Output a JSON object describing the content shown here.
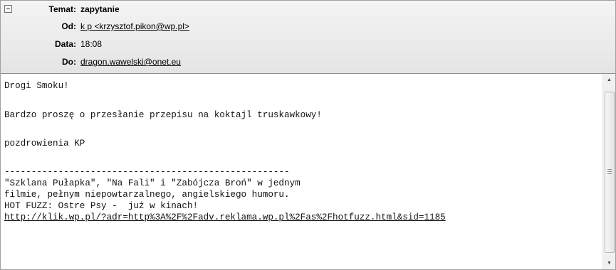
{
  "header": {
    "collapse_icon": "minus-box-icon",
    "subject": {
      "label": "Temat:",
      "value": "zapytanie"
    },
    "from": {
      "label": "Od:",
      "value": "k p <krzysztof.pikon@wp.pl>"
    },
    "date": {
      "label": "Data:",
      "value": "18:08"
    },
    "to": {
      "label": "Do:",
      "value": "dragon.wawelski@onet.eu"
    }
  },
  "body": {
    "greeting": "Drogi Smoku!",
    "request": "Bardzo proszę o przesłanie przepisu na koktajl truskawkowy!",
    "signoff": "pozdrowienia KP",
    "separator": "-----------------------------------------------------",
    "ad_line_1": "\"Szklana Pułapka\", \"Na Fali\" i \"Zabójcza Broń\" w jednym",
    "ad_line_2": "filmie, pełnym niepowtarzalnego, angielskiego humoru.",
    "ad_line_3": "HOT FUZZ: Ostre Psy -  już w kinach!",
    "ad_link": "http://klik.wp.pl/?adr=http%3A%2F%2Fadv.reklama.wp.pl%2Fas%2Fhotfuzz.html&sid=1185"
  },
  "scrollbar": {
    "up_icon": "scroll-up-arrow-icon",
    "down_icon": "scroll-down-arrow-icon"
  }
}
